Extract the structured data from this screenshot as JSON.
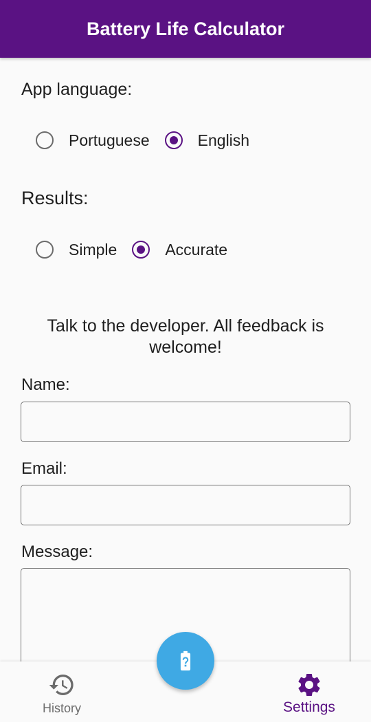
{
  "app_bar": {
    "title": "Battery Life Calculator"
  },
  "settings": {
    "language": {
      "label": "App language:",
      "options": [
        "Portuguese",
        "English"
      ],
      "selected": "English"
    },
    "results": {
      "label": "Results:",
      "options": [
        "Simple",
        "Accurate"
      ],
      "selected": "Accurate"
    }
  },
  "feedback": {
    "intro": "Talk to the developer. All feedback is welcome!",
    "name_label": "Name:",
    "name_value": "",
    "email_label": "Email:",
    "email_value": "",
    "message_label": "Message:",
    "message_value": ""
  },
  "fab": {
    "icon": "battery-unknown-icon"
  },
  "bottom_nav": {
    "items": [
      {
        "label": "History",
        "icon": "history-icon",
        "active": false
      },
      {
        "label": "Settings",
        "icon": "gear-icon",
        "active": true
      }
    ]
  },
  "colors": {
    "primary": "#5a1283",
    "fab": "#3fa9e4",
    "inactive": "#6b6b6b"
  }
}
